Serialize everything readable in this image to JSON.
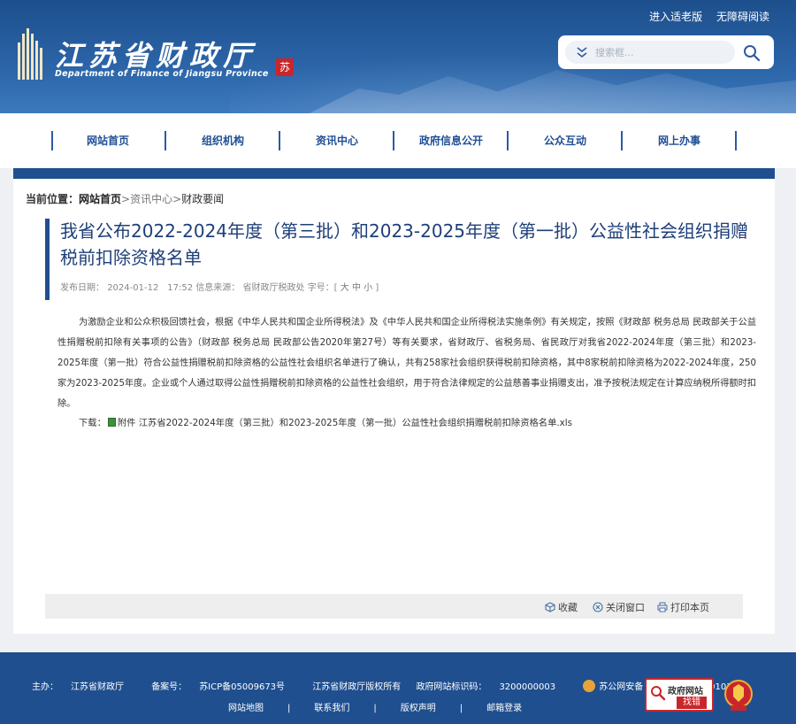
{
  "header": {
    "site_name_cn": "江苏省财政厅",
    "site_name_en": "Department of Finance of Jiangsu Province",
    "seal_char": "苏",
    "top_links": [
      "进入适老版",
      "无障碍阅读"
    ],
    "search_placeholder": "搜索框..."
  },
  "nav": {
    "items": [
      "网站首页",
      "组织机构",
      "资讯中心",
      "政府信息公开",
      "公众互动",
      "网上办事"
    ]
  },
  "breadcrumb": {
    "prefix": "当前位置：",
    "home": "网站首页",
    "sep": ">",
    "level1": "资讯中心",
    "level2": "财政要闻"
  },
  "article": {
    "title": "我省公布2022-2024年度（第三批）和2023-2025年度（第一批）公益性社会组织捐赠税前扣除资格名单",
    "meta": {
      "date_label": "发布日期：",
      "date": "2024-01-12　17:52",
      "source_label": "信息来源：",
      "source": "省财政厅税政处",
      "font_label": "字号：[",
      "size_large": "大",
      "size_medium": "中",
      "size_small": "小",
      "font_end": "]"
    },
    "body": "为激励企业和公众积极回馈社会，根据《中华人民共和国企业所得税法》及《中华人民共和国企业所得税法实施条例》有关规定，按照《财政部 税务总局 民政部关于公益性捐赠税前扣除有关事项的公告》（财政部 税务总局 民政部公告2020年第27号）等有关要求，省财政厅、省税务局、省民政厅对我省2022-2024年度（第三批）和2023-2025年度（第一批）符合公益性捐赠税前扣除资格的公益性社会组织名单进行了确认，共有258家社会组织获得税前扣除资格，其中8家税前扣除资格为2022-2024年度，250家为2023-2025年度。企业或个人通过取得公益性捐赠税前扣除资格的公益性社会组织，用于符合法律规定的公益慈善事业捐赠支出，准予按税法规定在计算应纳税所得额时扣除。",
    "download_label": "下载：",
    "attachment_label": "附件",
    "attachment_name": "江苏省2022-2024年度（第三批）和2023-2025年度（第一批）公益性社会组织捐赠税前扣除资格名单.xls"
  },
  "tools": {
    "favorite": "收藏",
    "close": "关闭窗口",
    "print": "打印本页"
  },
  "footer": {
    "sponsor_label": "主办：",
    "sponsor": "江苏省财政厅",
    "icp_label": "备案号：",
    "icp": "苏ICP备05009673号",
    "copyright": "江苏省财政厅版权所有",
    "site_id_label": "政府网站标识码：",
    "site_id": "3200000003",
    "police_label": "苏公网安备：",
    "police_id": "32010602010392",
    "links": [
      "网站地图",
      "联系我们",
      "版权声明",
      "邮箱登录"
    ],
    "link_sep": "|",
    "gov_badge_top": "政府网站",
    "gov_badge_bottom": "找错"
  },
  "colors": {
    "header_blue": "#2a63a6",
    "nav_text": "#1f4f95",
    "title_text": "#1e3f78",
    "footer_bg": "#1f4f8f",
    "badge_red": "#c9262b"
  }
}
